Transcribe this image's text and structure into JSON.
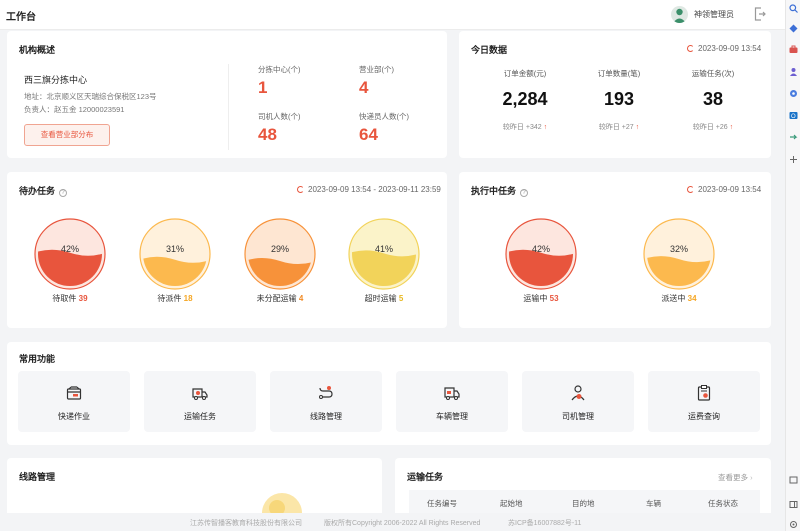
{
  "header": {
    "title": "工作台",
    "user_name": "神领管理员"
  },
  "overview": {
    "title": "机构概述",
    "org_name": "西三旗分拣中心",
    "address": "地址：北京顺义区天瑞综合保税区123号",
    "manager": "负责人：赵五金 12000023591",
    "button": "查看营业部分布",
    "stats": [
      {
        "label": "分拣中心(个)",
        "value": "1"
      },
      {
        "label": "营业部(个)",
        "value": "4"
      },
      {
        "label": "司机人数(个)",
        "value": "48"
      },
      {
        "label": "快递员人数(个)",
        "value": "64"
      }
    ]
  },
  "today": {
    "title": "今日数据",
    "time": "2023-09-09 13:54",
    "items": [
      {
        "label": "订单金额(元)",
        "value": "2,284",
        "compare": "较昨日 +342"
      },
      {
        "label": "订单数量(笔)",
        "value": "193",
        "compare": "较昨日 +27"
      },
      {
        "label": "运输任务(次)",
        "value": "38",
        "compare": "较昨日 +26"
      }
    ]
  },
  "pending": {
    "title": "待办任务",
    "time": "2023-09-09 13:54 - 2023-09-11 23:59",
    "gauges": [
      {
        "percent": "42%",
        "fill": 0.42,
        "label": "待取件",
        "count": "39",
        "color": "#e8553d",
        "bg": "#fde6df",
        "count_color": "#e8553d"
      },
      {
        "percent": "31%",
        "fill": 0.31,
        "label": "待派件",
        "count": "18",
        "color": "#fcb94e",
        "bg": "#fff1dc",
        "count_color": "#f5a623"
      },
      {
        "percent": "29%",
        "fill": 0.29,
        "label": "未分配运输",
        "count": "4",
        "color": "#f7923a",
        "bg": "#fee6d2",
        "count_color": "#f08a24"
      },
      {
        "percent": "41%",
        "fill": 0.41,
        "label": "超时运输",
        "count": "5",
        "color": "#f2d35a",
        "bg": "#fbf3c9",
        "count_color": "#e8b820"
      }
    ]
  },
  "executing": {
    "title": "执行中任务",
    "time": "2023-09-09 13:54",
    "gauges": [
      {
        "percent": "42%",
        "fill": 0.42,
        "label": "运输中",
        "count": "53",
        "color": "#e8553d",
        "bg": "#fde6df",
        "count_color": "#e8553d"
      },
      {
        "percent": "32%",
        "fill": 0.32,
        "label": "派送中",
        "count": "34",
        "color": "#fcb94e",
        "bg": "#fff1dc",
        "count_color": "#f5a623"
      }
    ]
  },
  "functions": {
    "title": "常用功能",
    "items": [
      {
        "label": "快递作业",
        "icon": "package-icon"
      },
      {
        "label": "运输任务",
        "icon": "delivery-truck-icon"
      },
      {
        "label": "线路管理",
        "icon": "route-icon"
      },
      {
        "label": "车辆管理",
        "icon": "truck-icon"
      },
      {
        "label": "司机管理",
        "icon": "driver-icon"
      },
      {
        "label": "运费查询",
        "icon": "freight-receipt-icon"
      }
    ]
  },
  "routes": {
    "title": "线路管理"
  },
  "transport": {
    "title": "运输任务",
    "more": "查看更多",
    "columns": [
      "任务编号",
      "起始地",
      "目的地",
      "车辆",
      "任务状态"
    ]
  },
  "footer": {
    "company": "江苏传智播客教育科技股份有限公司",
    "copyright": "版权所有Copyright 2006-2022 All Rights Reserved",
    "icp": "苏ICP备16007882号-11"
  }
}
